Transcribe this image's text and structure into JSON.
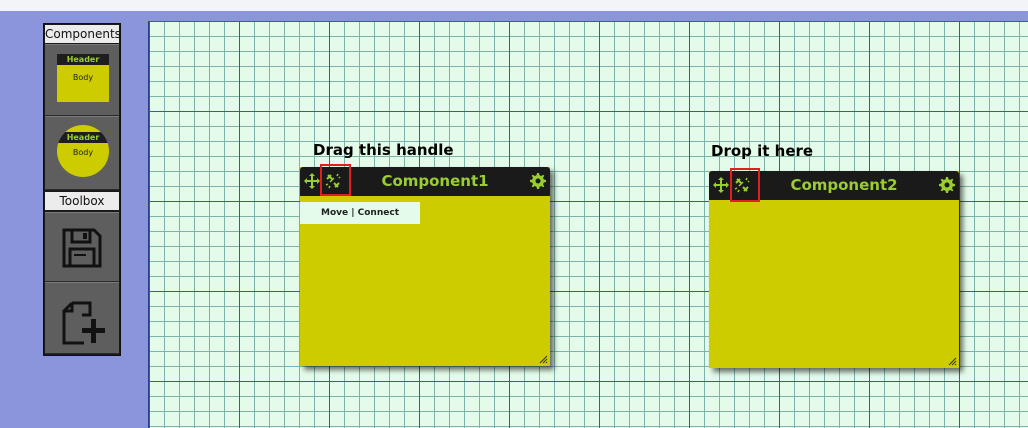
{
  "sidebar": {
    "components_title": "Components",
    "toolbox_title": "Toolbox",
    "rect_component": {
      "header": "Header",
      "body": "Body"
    },
    "circle_component": {
      "header": "Header",
      "body": "Body"
    },
    "tools": [
      {
        "icon": "save-icon"
      },
      {
        "icon": "new-page-icon"
      }
    ]
  },
  "annotations": {
    "drag_hint": "Drag this handle",
    "drop_hint": "Drop it here"
  },
  "components": [
    {
      "title": "Component1",
      "tooltip": "Move | Connect",
      "icons": [
        "move-icon",
        "connect-icon",
        "gear-icon"
      ]
    },
    {
      "title": "Component2",
      "icons": [
        "move-icon",
        "connect-icon",
        "gear-icon"
      ]
    }
  ],
  "colors": {
    "page_background": "#8a95dc",
    "canvas_background": "#e4fbea",
    "component_body": "#cccc00",
    "component_header": "#1a1a1a",
    "accent_green": "#9acd32",
    "highlight_red": "#e02020"
  }
}
